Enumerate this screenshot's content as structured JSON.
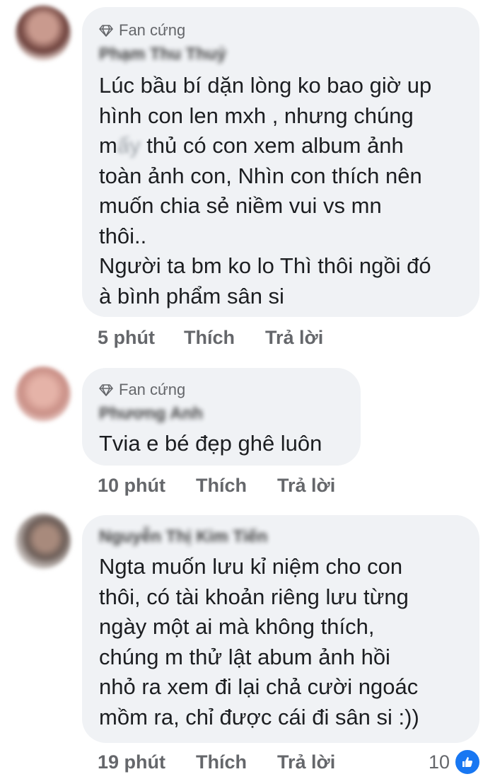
{
  "comments": [
    {
      "badge": "Fan cứng",
      "author": "Phạm Thu Thuỷ",
      "text_a": "Lúc bầu bí dặn lòng ko bao giờ up\nhình con len mxh , nhưng chúng\nm",
      "text_redacted": "ấy",
      "text_b": " thủ có con xem album ảnh\ntoàn ảnh con, Nhìn con thích nên\nmuốn chia sẻ niềm vui vs mn\nthôi..\nNgười ta bm ko lo Thì thôi ngồi đó\nà bình phẩm sân si",
      "time": "5 phút",
      "like": "Thích",
      "reply": "Trả lời"
    },
    {
      "badge": "Fan cứng",
      "author": "Phương Anh",
      "text": "Tvia e bé đẹp ghê luôn",
      "time": "10 phút",
      "like": "Thích",
      "reply": "Trả lời"
    },
    {
      "author": "Nguyễn Thị Kim Tiến",
      "text": "Ngta muốn lưu kỉ niệm cho con\nthôi, có tài khoản riêng lưu từng\nngày một ai mà không thích,\nchúng m thử lật abum ảnh hồi\nnhỏ ra xem đi lại chả cười ngoác\nmồm ra, chỉ được cái đi sân si :))",
      "time": "19 phút",
      "like": "Thích",
      "reply": "Trả lời",
      "reaction_count": "10",
      "reaction_icon": "like-thumb-icon"
    }
  ],
  "colors": {
    "bubble": "#f0f2f5",
    "meta": "#65676b",
    "like_blue": "#1877f2"
  }
}
